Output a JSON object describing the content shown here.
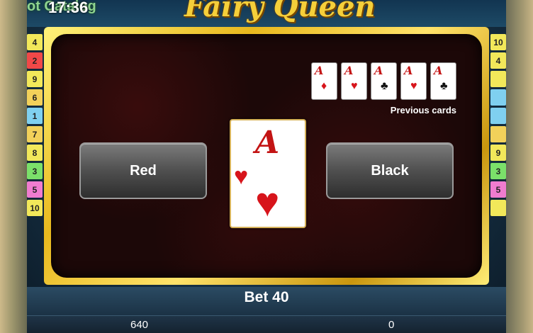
{
  "status": {
    "catalog_text": "ot Catalog",
    "clock": "17:36"
  },
  "game": {
    "title": "Fairy Queen"
  },
  "lines": {
    "left": [
      {
        "n": "4",
        "color": "#f2e85a"
      },
      {
        "n": "2",
        "color": "#f04848"
      },
      {
        "n": "9",
        "color": "#f2e85a"
      },
      {
        "n": "6",
        "color": "#f2d15a"
      },
      {
        "n": "1",
        "color": "#7fd0f0"
      },
      {
        "n": "7",
        "color": "#f2d15a"
      },
      {
        "n": "8",
        "color": "#f2e85a"
      },
      {
        "n": "3",
        "color": "#7be06a"
      },
      {
        "n": "5",
        "color": "#f07cd0"
      },
      {
        "n": "10",
        "color": "#f2e85a"
      }
    ],
    "right": [
      {
        "n": "10",
        "color": "#f2e85a"
      },
      {
        "n": "4",
        "color": "#f2e85a"
      },
      {
        "n": "",
        "color": "#f2e85a"
      },
      {
        "n": "",
        "color": "#7fd0f0"
      },
      {
        "n": "",
        "color": "#7fd0f0"
      },
      {
        "n": "",
        "color": "#f2d15a"
      },
      {
        "n": "9",
        "color": "#f2e85a"
      },
      {
        "n": "3",
        "color": "#7be06a"
      },
      {
        "n": "5",
        "color": "#f07cd0"
      },
      {
        "n": "",
        "color": "#f2e85a"
      }
    ]
  },
  "gamble": {
    "previous_cards_label": "Previous cards",
    "previous_cards": [
      {
        "rank": "A",
        "suit": "♦",
        "color": "#d7141b"
      },
      {
        "rank": "A",
        "suit": "♥",
        "color": "#d7141b"
      },
      {
        "rank": "A",
        "suit": "♣",
        "color": "#111111"
      },
      {
        "rank": "A",
        "suit": "♥",
        "color": "#d7141b"
      },
      {
        "rank": "A",
        "suit": "♣",
        "color": "#111111"
      }
    ],
    "current_card": {
      "rank": "A",
      "suit": "♥"
    },
    "red_label": "Red",
    "black_label": "Black"
  },
  "footer": {
    "bet": "Bet 40",
    "credit": "640",
    "win": "0"
  }
}
